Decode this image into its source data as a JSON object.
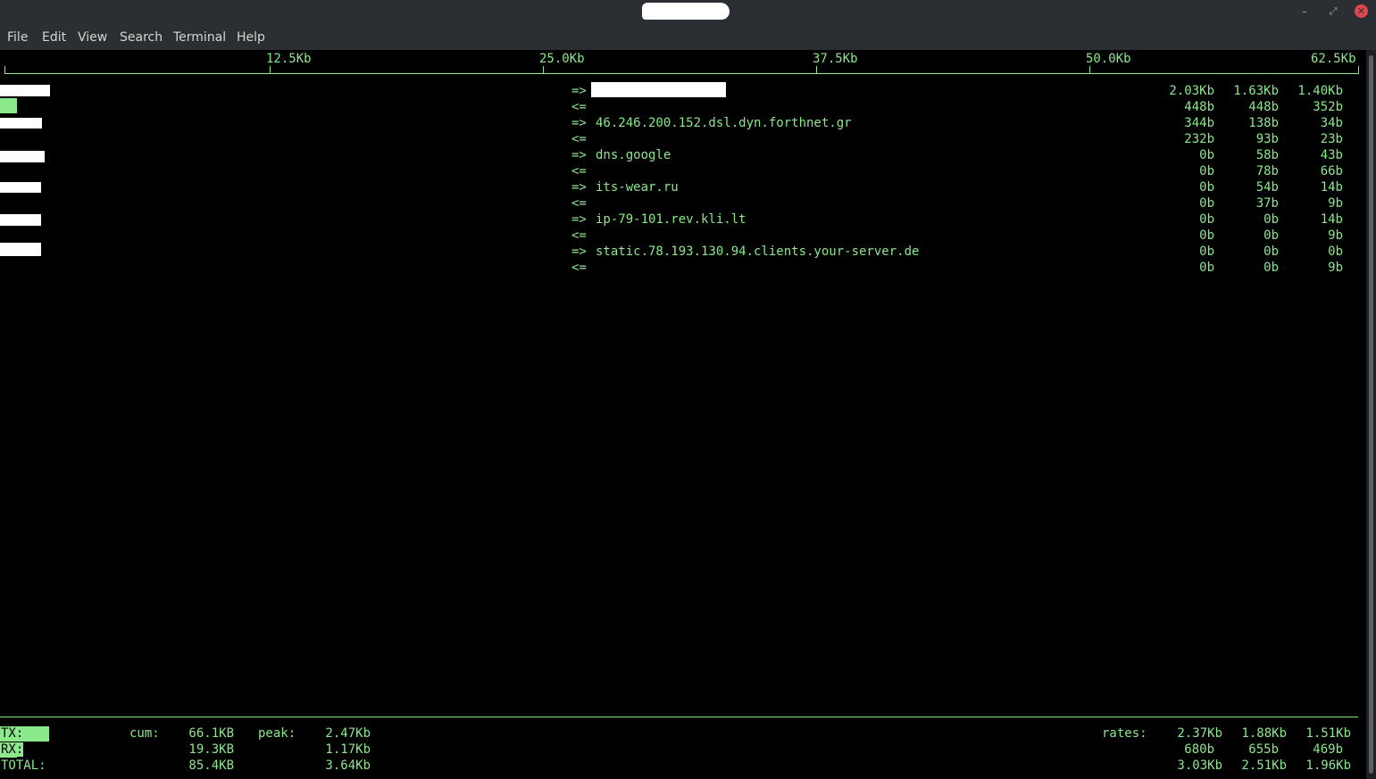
{
  "window": {
    "controls": {
      "minimize": "–",
      "maximize": "⤢",
      "close": "✕"
    }
  },
  "menubar": {
    "items": [
      "File",
      "Edit",
      "View",
      "Search",
      "Terminal",
      "Help"
    ]
  },
  "scale": {
    "labels": [
      "12.5Kb",
      "25.0Kb",
      "37.5Kb",
      "50.0Kb",
      "62.5Kb"
    ]
  },
  "connections": [
    {
      "dir": "=>",
      "host": "",
      "r2": "2.03Kb",
      "r10": "1.63Kb",
      "r40": "1.40Kb"
    },
    {
      "dir": "<=",
      "host": "",
      "r2": "448b",
      "r10": "448b",
      "r40": "352b"
    },
    {
      "dir": "=>",
      "host": "46.246.200.152.dsl.dyn.forthnet.gr",
      "r2": "344b",
      "r10": "138b",
      "r40": "34b"
    },
    {
      "dir": "<=",
      "host": "",
      "r2": "232b",
      "r10": "93b",
      "r40": "23b"
    },
    {
      "dir": "=>",
      "host": "dns.google",
      "r2": "0b",
      "r10": "58b",
      "r40": "43b"
    },
    {
      "dir": "<=",
      "host": "",
      "r2": "0b",
      "r10": "78b",
      "r40": "66b"
    },
    {
      "dir": "=>",
      "host": "its-wear.ru",
      "r2": "0b",
      "r10": "54b",
      "r40": "14b"
    },
    {
      "dir": "<=",
      "host": "",
      "r2": "0b",
      "r10": "37b",
      "r40": "9b"
    },
    {
      "dir": "=>",
      "host": "ip-79-101.rev.kli.lt",
      "r2": "0b",
      "r10": "0b",
      "r40": "14b"
    },
    {
      "dir": "<=",
      "host": "",
      "r2": "0b",
      "r10": "0b",
      "r40": "9b"
    },
    {
      "dir": "=>",
      "host": "static.78.193.130.94.clients.your-server.de",
      "r2": "0b",
      "r10": "0b",
      "r40": "0b"
    },
    {
      "dir": "<=",
      "host": "",
      "r2": "0b",
      "r10": "0b",
      "r40": "9b"
    }
  ],
  "totals": {
    "tx_label": "TX:",
    "rx_label": "RX:",
    "total_label": "TOTAL:",
    "cum_label": "cum:",
    "peak_label": "peak:",
    "rates_label": "rates:",
    "tx": {
      "cum": "66.1KB",
      "peak": "2.47Kb",
      "r2": "2.37Kb",
      "r10": "1.88Kb",
      "r40": "1.51Kb"
    },
    "rx": {
      "cum": "19.3KB",
      "peak": "1.17Kb",
      "r2": "680b",
      "r10": "655b",
      "r40": "469b"
    },
    "total": {
      "cum": "85.4KB",
      "peak": "3.64Kb",
      "r2": "3.03Kb",
      "r10": "2.51Kb",
      "r40": "1.96Kb"
    }
  },
  "colors": {
    "terminal_fg": "#8be88b",
    "terminal_bg": "#000000",
    "chrome_bg": "#2b2e33"
  }
}
